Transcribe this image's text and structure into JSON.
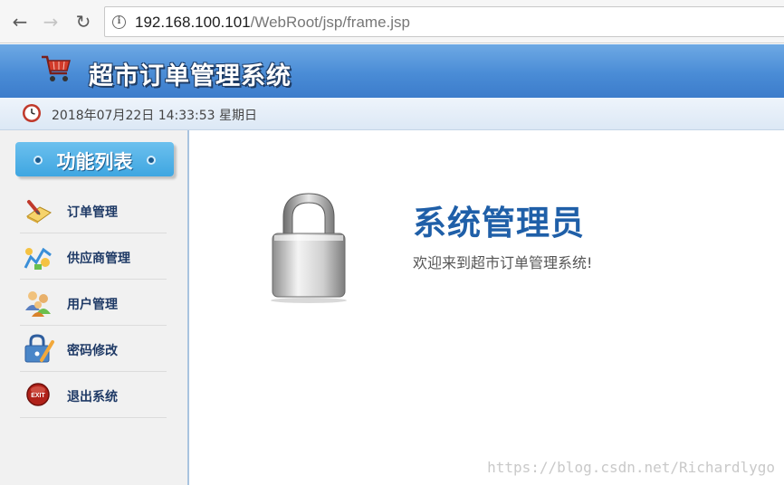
{
  "browser": {
    "back_icon": "arrow-left-icon",
    "forward_icon": "arrow-right-icon",
    "reload_icon": "reload-icon",
    "url_host": "192.168.100.101",
    "url_path": "/WebRoot/jsp/frame.jsp"
  },
  "header": {
    "title": "超市订单管理系统",
    "icon": "shopping-cart-icon"
  },
  "datebar": {
    "datetime": "2018年07月22日 14:33:53 星期日",
    "icon": "clock-icon"
  },
  "sidebar": {
    "title": "功能列表",
    "items": [
      {
        "label": "订单管理",
        "icon": "order-icon"
      },
      {
        "label": "供应商管理",
        "icon": "supplier-icon"
      },
      {
        "label": "用户管理",
        "icon": "users-icon"
      },
      {
        "label": "密码修改",
        "icon": "password-icon"
      },
      {
        "label": "退出系统",
        "icon": "exit-icon"
      }
    ]
  },
  "main": {
    "role": "系统管理员",
    "welcome": "欢迎来到超市订单管理系统!",
    "icon": "lock-icon"
  },
  "watermark": "https://blog.csdn.net/Richardlygo",
  "colors": {
    "header_blue": "#4a8cd6",
    "title_blue": "#1f5fa8",
    "menu_text": "#1f3a66"
  }
}
